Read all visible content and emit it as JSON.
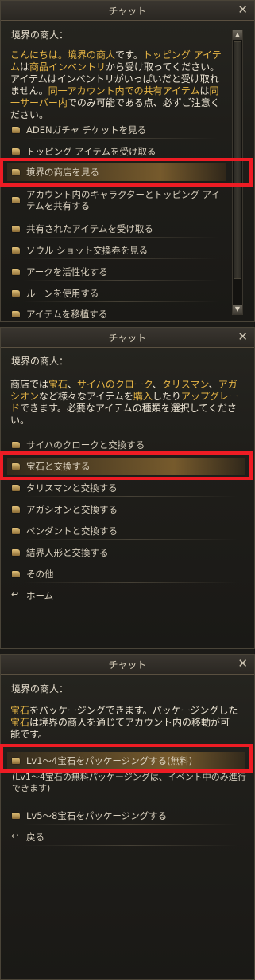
{
  "panel1": {
    "title": "チャット",
    "speaker": "境界の商人：",
    "message": [
      {
        "t": "こんにちは。境界の商人",
        "h": true
      },
      {
        "t": "です。",
        "h": false
      },
      {
        "t": "トッピング アイテム",
        "h": true
      },
      {
        "t": "は",
        "h": false
      },
      {
        "t": "商品インベントリ",
        "h": true
      },
      {
        "t": "から受け取ってください。アイテムはインベントリがいっぱいだと受け取れません。",
        "h": false
      },
      {
        "t": "同一アカウント内での共有アイテム",
        "h": true
      },
      {
        "t": "は",
        "h": false
      },
      {
        "t": "同一サーバー内",
        "h": true
      },
      {
        "t": "でのみ可能である点、必ずご注意ください。",
        "h": false
      }
    ],
    "options": [
      "ADENガチャ チケットを見る",
      "トッピング アイテムを受け取る",
      "境界の商店を見る",
      "アカウント内のキャラクターとトッピング アイテムを共有する",
      "共有されたアイテムを受け取る",
      "ソウル ショット交換券を見る",
      "アークを活性化する",
      "ルーンを使用する",
      "アイテムを移植する"
    ],
    "selected_index": 2
  },
  "panel2": {
    "title": "チャット",
    "speaker": "境界の商人：",
    "message": [
      {
        "t": "商店では",
        "h": false
      },
      {
        "t": "宝石",
        "h": true
      },
      {
        "t": "、",
        "h": false
      },
      {
        "t": "サイハのクローク",
        "h": true
      },
      {
        "t": "、",
        "h": false
      },
      {
        "t": "タリスマン",
        "h": true
      },
      {
        "t": "、",
        "h": false
      },
      {
        "t": "アガシオン",
        "h": true
      },
      {
        "t": "など様々なアイテムを",
        "h": false
      },
      {
        "t": "購入",
        "h": true
      },
      {
        "t": "したり",
        "h": false
      },
      {
        "t": "アップグレード",
        "h": true
      },
      {
        "t": "できます。必要なアイテムの種類を選択してください。",
        "h": false
      }
    ],
    "options": [
      "サイハのクロークと交換する",
      "宝石と交換する",
      "タリスマンと交換する",
      "アガシオンと交換する",
      "ペンダントと交換する",
      "結界人形と交換する",
      "その他",
      "ホーム"
    ],
    "selected_index": 1
  },
  "panel3": {
    "title": "チャット",
    "speaker": "境界の商人：",
    "message": [
      {
        "t": "宝石",
        "h": true
      },
      {
        "t": "をパッケージングできます。パッケージングした",
        "h": false
      },
      {
        "t": "宝石",
        "h": true
      },
      {
        "t": "は境界の商人を通じてアカウント内の移動が可能です。",
        "h": false
      }
    ],
    "option_selected": "Lv1～4宝石をパッケージングする(無料)",
    "note": "(Lv1～4宝石の無料パッケージングは、イベント中のみ進行できます)",
    "options": [
      "Lv5～8宝石をパッケージングする",
      "戻る"
    ]
  },
  "icons": {
    "close": "close-icon",
    "option": "dialog-option-icon",
    "return": "return-arrow-icon",
    "scroll_up": "scroll-up-icon",
    "scroll_down": "scroll-down-icon"
  },
  "colors": {
    "highlight": "#e6b545",
    "selection_box": "#ee1c24"
  }
}
